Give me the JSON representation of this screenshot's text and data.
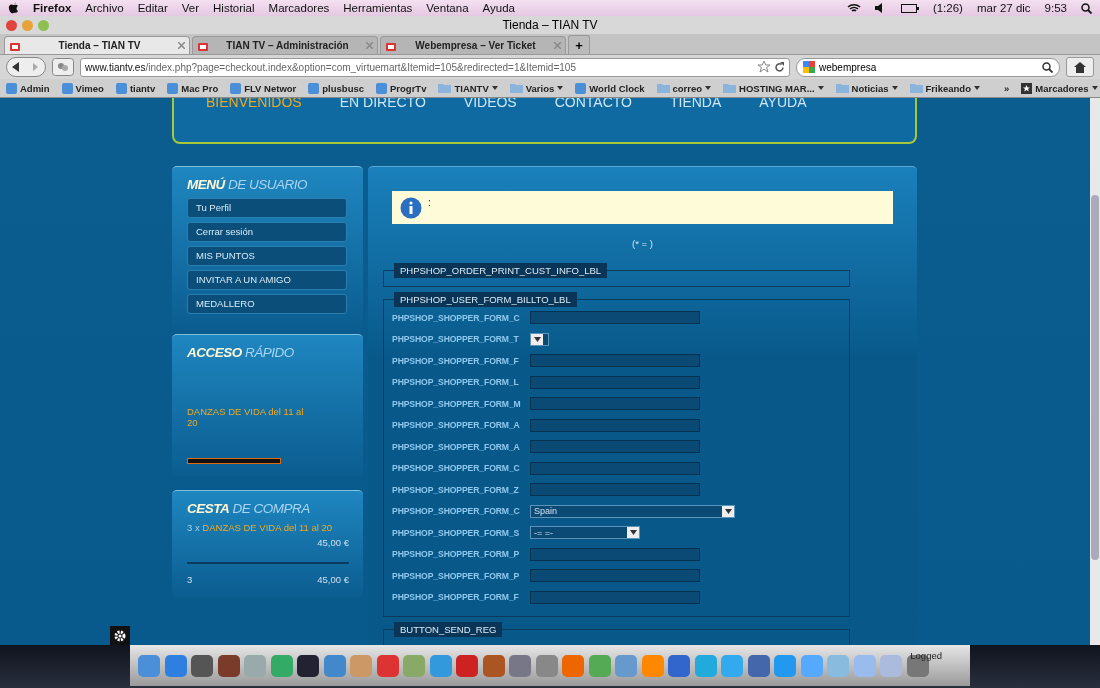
{
  "menubar": {
    "app": "Firefox",
    "menus": [
      "Archivo",
      "Editar",
      "Ver",
      "Historial",
      "Marcadores",
      "Herramientas",
      "Ventana",
      "Ayuda"
    ],
    "battery": "(1:26)",
    "date": "mar 27 dic",
    "time": "9:53"
  },
  "window": {
    "title": "Tienda – TIAN TV"
  },
  "tabs": [
    {
      "label": "Tienda – TIAN TV",
      "selected": true
    },
    {
      "label": "TIAN TV – Administración",
      "selected": false
    },
    {
      "label": "Webempresa – Ver Ticket",
      "selected": false
    }
  ],
  "new_tab": "+",
  "address": {
    "domain": "www.tiantv.es",
    "path": "/index.php?page=checkout.index&option=com_virtuemart&Itemid=105&redirected=1&Itemid=105"
  },
  "search": {
    "value": "webempresa"
  },
  "bookmarks": [
    {
      "label": "Admin",
      "kind": "link"
    },
    {
      "label": "Vimeo",
      "kind": "link"
    },
    {
      "label": "tiantv",
      "kind": "link"
    },
    {
      "label": "Mac Pro",
      "kind": "link"
    },
    {
      "label": "FLV Networ",
      "kind": "link"
    },
    {
      "label": "plusbusc",
      "kind": "link"
    },
    {
      "label": "ProgrTv",
      "kind": "link"
    },
    {
      "label": "TIANTV",
      "kind": "folder"
    },
    {
      "label": "Varios",
      "kind": "folder"
    },
    {
      "label": "World Clock",
      "kind": "link"
    },
    {
      "label": "correo",
      "kind": "folder"
    },
    {
      "label": "HOSTING MAR...",
      "kind": "folder"
    },
    {
      "label": "Noticias",
      "kind": "folder"
    },
    {
      "label": "Frikeando",
      "kind": "folder"
    }
  ],
  "bookmarks_more": "»",
  "bookmarks_menu": "Marcadores",
  "site_nav": [
    {
      "label": "BIENVENIDOS",
      "selected": true
    },
    {
      "label": "EN DIRECTO",
      "selected": false
    },
    {
      "label": "VIDEOS",
      "selected": false
    },
    {
      "label": "CONTACTO",
      "selected": false
    },
    {
      "label": "TIENDA",
      "selected": false
    },
    {
      "label": "AYUDA",
      "selected": false
    }
  ],
  "user_menu": {
    "title_bold": "MENÚ",
    "title_rest": "DE USUARIO",
    "items": [
      "Tu Perfil",
      "Cerrar sesión",
      "MIS PUNTOS",
      "INVITAR A UN AMIGO",
      "MEDALLERO"
    ]
  },
  "quick_access": {
    "title_bold": "ACCESO",
    "title_rest": "RÁPIDO",
    "link": "DANZAS DE VIDA del 11 al 20"
  },
  "cart": {
    "title_bold": "CESTA",
    "title_rest": "DE COMPRA",
    "qty_prefix": "3 x",
    "product": "DANZAS DE VIDA del 11 al 20",
    "price": "45,00 €",
    "total_qty": "3",
    "total": "45,00 €"
  },
  "notice": {
    "text": ":"
  },
  "required_note": "(* = )",
  "sections": [
    {
      "legend": "PHPSHOP_ORDER_PRINT_CUST_INFO_LBL"
    },
    {
      "legend": "PHPSHOP_USER_FORM_BILLTO_LBL",
      "fields": [
        {
          "label": "PHPSHOP_SHOPPER_FORM_C",
          "kind": "text"
        },
        {
          "label": "PHPSHOP_SHOPPER_FORM_T",
          "kind": "mini-select"
        },
        {
          "label": "PHPSHOP_SHOPPER_FORM_F",
          "kind": "text"
        },
        {
          "label": "PHPSHOP_SHOPPER_FORM_L",
          "kind": "text"
        },
        {
          "label": "PHPSHOP_SHOPPER_FORM_M",
          "kind": "text"
        },
        {
          "label": "PHPSHOP_SHOPPER_FORM_A",
          "kind": "text"
        },
        {
          "label": "PHPSHOP_SHOPPER_FORM_A",
          "kind": "text"
        },
        {
          "label": "PHPSHOP_SHOPPER_FORM_C",
          "kind": "text"
        },
        {
          "label": "PHPSHOP_SHOPPER_FORM_Z",
          "kind": "text"
        },
        {
          "label": "PHPSHOP_SHOPPER_FORM_C",
          "kind": "select",
          "value": "Spain"
        },
        {
          "label": "PHPSHOP_SHOPPER_FORM_S",
          "kind": "short-select",
          "value": "-= =-"
        },
        {
          "label": "PHPSHOP_SHOPPER_FORM_P",
          "kind": "text"
        },
        {
          "label": "PHPSHOP_SHOPPER_FORM_P",
          "kind": "text"
        },
        {
          "label": "PHPSHOP_SHOPPER_FORM_F",
          "kind": "text"
        }
      ]
    },
    {
      "legend": "BUTTON_SEND_REG"
    }
  ],
  "dock": {
    "status": "Logged"
  }
}
